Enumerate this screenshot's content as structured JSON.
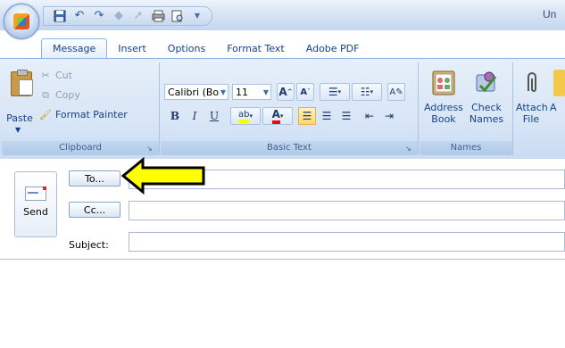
{
  "window": {
    "title": "Un"
  },
  "quick_access": {
    "icons": [
      "save-icon",
      "undo-icon",
      "redo-icon",
      "up-arrow-icon",
      "down-arrow-icon",
      "print-icon",
      "print-preview-icon",
      "customize-dropdown-icon"
    ]
  },
  "tabs": [
    {
      "label": "Message",
      "active": true
    },
    {
      "label": "Insert",
      "active": false
    },
    {
      "label": "Options",
      "active": false
    },
    {
      "label": "Format Text",
      "active": false
    },
    {
      "label": "Adobe PDF",
      "active": false
    }
  ],
  "clipboard": {
    "paste_label": "Paste",
    "cut_label": "Cut",
    "copy_label": "Copy",
    "format_painter_label": "Format Painter",
    "group_label": "Clipboard"
  },
  "basic_text": {
    "font_name": "Calibri (Bo",
    "font_size": "11",
    "bold": "B",
    "italic": "I",
    "underline": "U",
    "group_label": "Basic Text"
  },
  "names": {
    "address_book_label_1": "Address",
    "address_book_label_2": "Book",
    "check_names_label_1": "Check",
    "check_names_label_2": "Names",
    "group_label": "Names"
  },
  "include": {
    "attach_label_1": "Attach",
    "attach_label_2": "File",
    "next_label": "A"
  },
  "compose": {
    "send_label": "Send",
    "to_button": "To...",
    "cc_button": "Cc...",
    "subject_label": "Subject:",
    "to_value": "",
    "cc_value": "",
    "subject_value": ""
  },
  "colors": {
    "ribbon_text": "#15428b",
    "highlight_yellow": "#ffff00",
    "font_color_red": "#ff0000"
  }
}
